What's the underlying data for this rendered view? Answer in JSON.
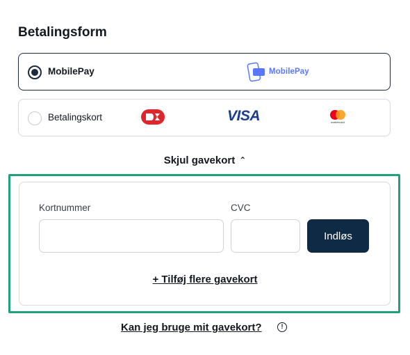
{
  "section_title": "Betalingsform",
  "payment_options": [
    {
      "label": "MobilePay",
      "selected": true,
      "logo_text": "MobilePay"
    },
    {
      "label": "Betalingskort",
      "selected": false,
      "card_brands": [
        "dankort",
        "VISA",
        "mastercard"
      ]
    }
  ],
  "gift_card": {
    "toggle_label": "Skjul gavekort",
    "number_label": "Kortnummer",
    "number_value": "",
    "cvc_label": "CVC",
    "cvc_value": "",
    "redeem_label": "Indløs",
    "add_more_label": "+ Tilføj flere gavekort"
  },
  "faq_link": "Kan jeg bruge mit gavekort?",
  "info_icon_glyph": "!",
  "colors": {
    "accent_dark": "#0f2a44",
    "focus_ring": "#21a07d",
    "mobilepay_blue": "#5a78ff",
    "visa_blue": "#1a3d8f",
    "dankort_red": "#e0262d"
  }
}
